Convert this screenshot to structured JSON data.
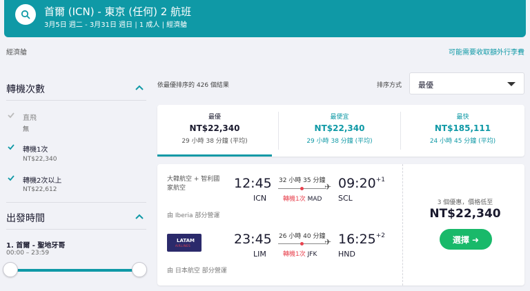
{
  "header": {
    "title": "首爾 (ICN) - 東京 (任何) 2 航班",
    "subtitle": "3月5日 週二 - 3月31日 週日 | 1 成人 | 經濟艙"
  },
  "cabin_note": "經濟艙",
  "fee_link": "可能需要收取額外行李費",
  "sidebar": {
    "stops_title": "轉機次數",
    "stops_options": [
      {
        "label": "直飛",
        "price": "無",
        "checked": true,
        "disabled": true
      },
      {
        "label": "轉機1次",
        "price": "NT$22,340",
        "checked": true,
        "disabled": false
      },
      {
        "label": "轉機2次以上",
        "price": "NT$22,612",
        "checked": true,
        "disabled": false
      }
    ],
    "departure_title": "出發時間",
    "departure_route": "1. 首爾 - 聖地牙哥",
    "departure_range": "00:00 – 23:59"
  },
  "results": {
    "sort_text": "依最優排序的 426 個結果",
    "sort_label": "排序方式",
    "sort_value": "最優"
  },
  "tabs": [
    {
      "title": "最優",
      "price": "NT$22,340",
      "time": "29 小時 38 分鐘 (平均)",
      "active": true
    },
    {
      "title": "最便宜",
      "price": "NT$22,340",
      "time": "29 小時 38 分鐘 (平均)",
      "active": false
    },
    {
      "title": "最快",
      "price": "NT$185,111",
      "time": "24 小時 45 分鐘 (平均)",
      "active": false
    }
  ],
  "result": {
    "leg1": {
      "airline": "大韓航空 + 智利國家航空",
      "dep_time": "12:45",
      "dep_code": "ICN",
      "duration": "32 小時 35 分鐘",
      "stops_text": "轉機1次",
      "stop_code": "MAD",
      "arr_time": "09:20",
      "arr_offset": "+1",
      "arr_code": "SCL",
      "operated": "由 Iberia 部分營運"
    },
    "leg2": {
      "logo_text": "LATAM",
      "logo_sub": "AIRLINES",
      "dep_time": "23:45",
      "dep_code": "LIM",
      "duration": "26 小時 40 分鐘",
      "stops_text": "轉機1次",
      "stop_code": "JFK",
      "arr_time": "16:25",
      "arr_offset": "+2",
      "arr_code": "HND",
      "operated": "由 日本航空 部分營運"
    },
    "deal_note": "3 個優惠，價格低至",
    "price": "NT$22,340",
    "select_label": "選擇 ➜"
  },
  "colors": {
    "accent": "#0f99a6",
    "select": "#19b96a",
    "stop_red": "#e8434f"
  }
}
